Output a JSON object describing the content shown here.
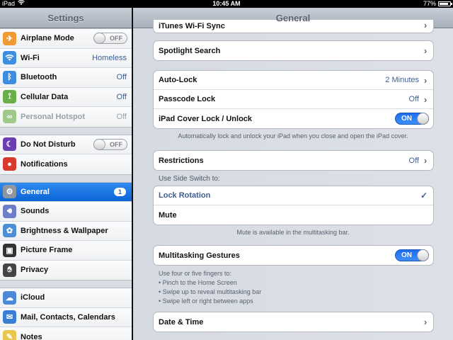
{
  "status": {
    "device": "iPad",
    "time": "10:45 AM",
    "battery": "77%"
  },
  "master": {
    "title": "Settings",
    "groups": [
      [
        {
          "label": "Airplane Mode",
          "toggle": "OFF",
          "icon": "airplane-icon",
          "color": "#f19a32"
        },
        {
          "label": "Wi-Fi",
          "value": "Homeless",
          "icon": "wifi-icon",
          "color": "#3d8de0"
        },
        {
          "label": "Bluetooth",
          "value": "Off",
          "icon": "bluetooth-icon",
          "color": "#3d8de0"
        },
        {
          "label": "Cellular Data",
          "value": "Off",
          "icon": "cellular-icon",
          "color": "#6ab04a"
        },
        {
          "label": "Personal Hotspot",
          "value": "Off",
          "icon": "hotspot-icon",
          "color": "#9fc98a",
          "dim": true
        }
      ],
      [
        {
          "label": "Do Not Disturb",
          "toggle": "OFF",
          "icon": "moon-icon",
          "color": "#6a3fb0"
        },
        {
          "label": "Notifications",
          "icon": "notifications-icon",
          "color": "#d83a2e"
        }
      ],
      [
        {
          "label": "General",
          "badge": "1",
          "icon": "gear-icon",
          "color": "#8e96a3",
          "selected": true
        },
        {
          "label": "Sounds",
          "icon": "speaker-icon",
          "color": "#6b7ec7"
        },
        {
          "label": "Brightness & Wallpaper",
          "icon": "brightness-icon",
          "color": "#4d8fd6"
        },
        {
          "label": "Picture Frame",
          "icon": "picture-frame-icon",
          "color": "#333"
        },
        {
          "label": "Privacy",
          "icon": "hand-icon",
          "color": "#444"
        }
      ],
      [
        {
          "label": "iCloud",
          "icon": "cloud-icon",
          "color": "#4d88d6"
        },
        {
          "label": "Mail, Contacts, Calendars",
          "icon": "mail-icon",
          "color": "#3a7fd6"
        },
        {
          "label": "Notes",
          "icon": "notes-icon",
          "color": "#e8c84c"
        }
      ]
    ]
  },
  "detail": {
    "title": "General",
    "partial_top": "iTunes Wi-Fi Sync",
    "spotlight": "Spotlight Search",
    "autolock": {
      "label": "Auto-Lock",
      "value": "2 Minutes"
    },
    "passcode": {
      "label": "Passcode Lock",
      "value": "Off"
    },
    "cover": {
      "label": "iPad Cover Lock / Unlock",
      "toggle": "ON"
    },
    "cover_note": "Automatically lock and unlock your iPad when you close and open the iPad cover.",
    "restrictions": {
      "label": "Restrictions",
      "value": "Off"
    },
    "side_switch_header": "Use Side Switch to:",
    "lock_rotation": "Lock Rotation",
    "mute": "Mute",
    "mute_note": "Mute is available in the multitasking bar.",
    "multitasking": {
      "label": "Multitasking Gestures",
      "toggle": "ON"
    },
    "gestures_note": [
      "Use four or five fingers to:",
      "• Pinch to the Home Screen",
      "• Swipe up to reveal multitasking bar",
      "• Swipe left or right between apps"
    ],
    "datetime": "Date & Time"
  }
}
